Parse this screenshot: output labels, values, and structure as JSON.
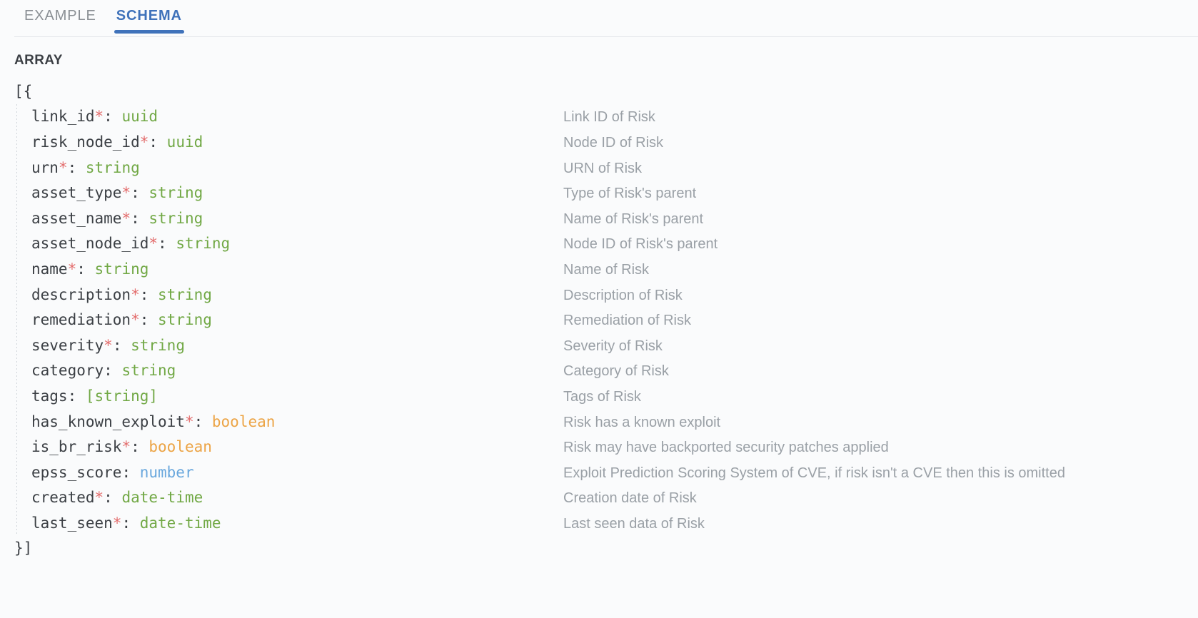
{
  "tabs": [
    {
      "id": "example",
      "label": "EXAMPLE",
      "active": false
    },
    {
      "id": "schema",
      "label": "SCHEMA",
      "active": true
    }
  ],
  "schema": {
    "root_type_label": "ARRAY",
    "open_token": "[{",
    "close_token": "}]",
    "required_marker": "*",
    "separator": ": ",
    "fields": [
      {
        "name": "link_id",
        "required": true,
        "type": "uuid",
        "type_kind": "uuid",
        "description": "Link ID of Risk"
      },
      {
        "name": "risk_node_id",
        "required": true,
        "type": "uuid",
        "type_kind": "uuid",
        "description": "Node ID of Risk"
      },
      {
        "name": "urn",
        "required": true,
        "type": "string",
        "type_kind": "string",
        "description": "URN of Risk"
      },
      {
        "name": "asset_type",
        "required": true,
        "type": "string",
        "type_kind": "string",
        "description": "Type of Risk's parent"
      },
      {
        "name": "asset_name",
        "required": true,
        "type": "string",
        "type_kind": "string",
        "description": "Name of Risk's parent"
      },
      {
        "name": "asset_node_id",
        "required": true,
        "type": "string",
        "type_kind": "string",
        "description": "Node ID of Risk's parent"
      },
      {
        "name": "name",
        "required": true,
        "type": "string",
        "type_kind": "string",
        "description": "Name of Risk"
      },
      {
        "name": "description",
        "required": true,
        "type": "string",
        "type_kind": "string",
        "description": "Description of Risk"
      },
      {
        "name": "remediation",
        "required": true,
        "type": "string",
        "type_kind": "string",
        "description": "Remediation of Risk"
      },
      {
        "name": "severity",
        "required": true,
        "type": "string",
        "type_kind": "string",
        "description": "Severity of Risk"
      },
      {
        "name": "category",
        "required": false,
        "type": "string",
        "type_kind": "string",
        "description": "Category of Risk"
      },
      {
        "name": "tags",
        "required": false,
        "type": "[string]",
        "type_kind": "array",
        "description": "Tags of Risk"
      },
      {
        "name": "has_known_exploit",
        "required": true,
        "type": "boolean",
        "type_kind": "boolean",
        "description": "Risk has a known exploit"
      },
      {
        "name": "is_br_risk",
        "required": true,
        "type": "boolean",
        "type_kind": "boolean",
        "description": "Risk may have backported security patches applied"
      },
      {
        "name": "epss_score",
        "required": false,
        "type": "number",
        "type_kind": "number",
        "description": "Exploit Prediction Scoring System of CVE, if risk isn't a CVE then this is omitted"
      },
      {
        "name": "created",
        "required": true,
        "type": "date-time",
        "type_kind": "datetime",
        "description": "Creation date of Risk"
      },
      {
        "name": "last_seen",
        "required": true,
        "type": "date-time",
        "type_kind": "datetime",
        "description": "Last seen data of Risk"
      }
    ]
  },
  "colors": {
    "accent": "#3f72ba",
    "required_marker": "#e36c6c",
    "type_string": "#71a845",
    "type_boolean": "#eca445",
    "type_number": "#69a7dd",
    "field_name": "#3b3f44",
    "description": "#9aa0a6",
    "background": "#fafbfc"
  }
}
